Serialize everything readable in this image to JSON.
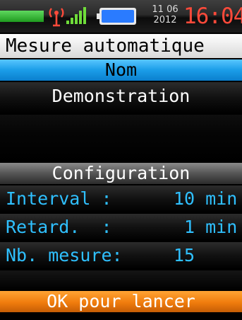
{
  "status": {
    "date_line1": "11 06",
    "date_line2": "2012",
    "time": "16:04",
    "colors": {
      "time": "#ff4a3a",
      "battery": "#2a7bff",
      "signal": "#6fdc3a",
      "antenna": "#ff4a3a"
    },
    "icons": [
      "antenna-icon",
      "signal-strength-icon",
      "battery-icon"
    ]
  },
  "title": "Mesure automatique",
  "sections": {
    "name_header": "Nom",
    "name_value": "Demonstration",
    "config_header": "Configuration",
    "config_items": [
      {
        "label": "Interval :",
        "value": "10 min"
      },
      {
        "label": "Retard.  :",
        "value": "1 min"
      },
      {
        "label": "Nb. mesure:",
        "value": "15"
      }
    ]
  },
  "footer": {
    "action_label": "OK pour lancer"
  },
  "colors": {
    "header_blue": "#1b9de8",
    "header_grey": "#555555",
    "header_orange": "#f07c0d",
    "config_text": "#2fc0ff"
  }
}
